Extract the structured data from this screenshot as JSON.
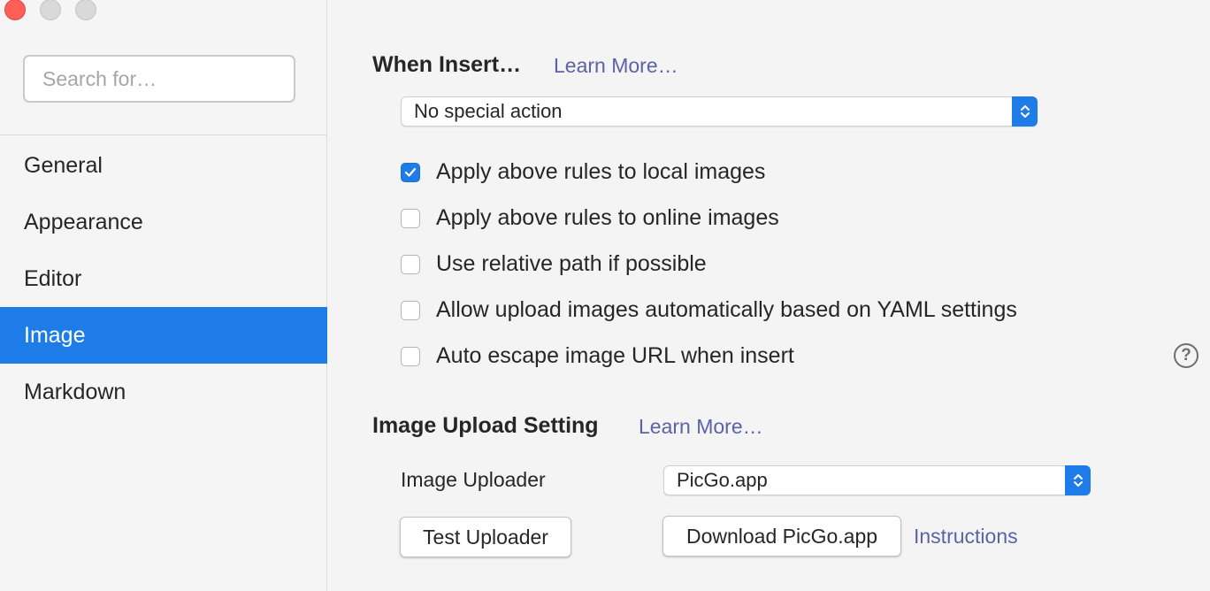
{
  "window": {
    "controls": [
      "close",
      "minimize",
      "maximize"
    ]
  },
  "sidebar": {
    "search_placeholder": "Search for…",
    "items": [
      {
        "label": "General",
        "active": false
      },
      {
        "label": "Appearance",
        "active": false
      },
      {
        "label": "Editor",
        "active": false
      },
      {
        "label": "Image",
        "active": true
      },
      {
        "label": "Markdown",
        "active": false
      }
    ]
  },
  "insert": {
    "title": "When Insert…",
    "learn_more": "Learn More…",
    "action_selected": "No special action",
    "options": [
      {
        "label": "Apply above rules to local images",
        "checked": true
      },
      {
        "label": "Apply above rules to online images",
        "checked": false
      },
      {
        "label": "Use relative path if possible",
        "checked": false
      },
      {
        "label": "Allow upload images automatically based on YAML settings",
        "checked": false
      },
      {
        "label": "Auto escape image URL when insert",
        "checked": false
      }
    ],
    "help_icon": "?"
  },
  "upload": {
    "title": "Image Upload Setting",
    "learn_more": "Learn More…",
    "uploader_label": "Image Uploader",
    "uploader_selected": "PicGo.app",
    "test_button": "Test Uploader",
    "download_button": "Download PicGo.app",
    "instructions_link": "Instructions"
  },
  "colors": {
    "accent": "#1e7ce8",
    "link": "#5b63a6",
    "close": "#fe5f57"
  }
}
